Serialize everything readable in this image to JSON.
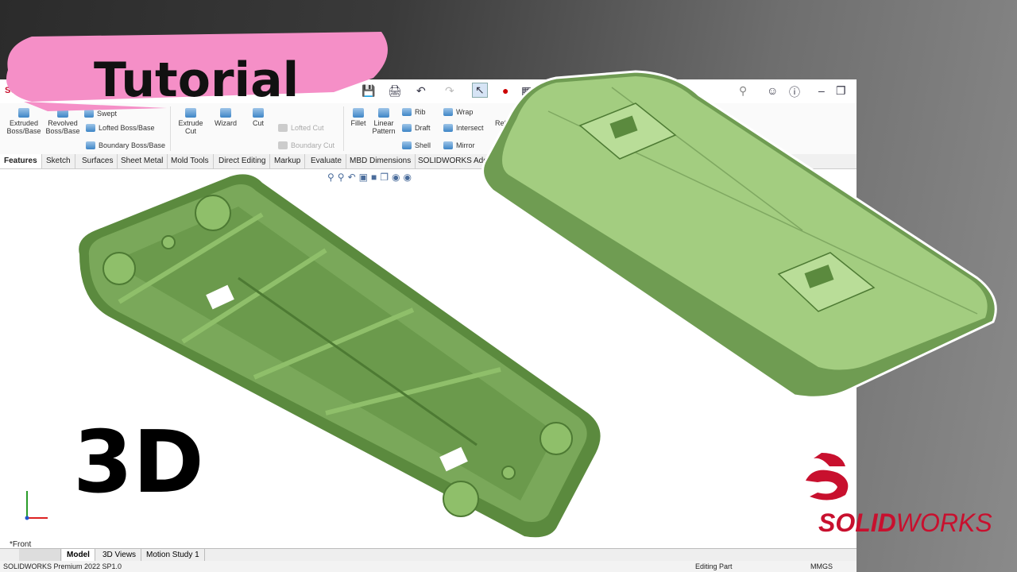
{
  "thumbnail": {
    "tutorial_label": "Tutorial",
    "big_label": "3D",
    "brand": {
      "bold": "SOLID",
      "thin": "WORKS"
    }
  },
  "app": {
    "logo_text": "SOLIDWORKS",
    "ribbon": {
      "extruded": "Extruded Boss/Base",
      "revolved": "Revolved Boss/Base",
      "swept": "Swept",
      "lofted": "Lofted Boss/Base",
      "boundary": "Boundary Boss/Base",
      "extrude_cut": "Extrude Cut",
      "hole_wizard": "Wizard",
      "cut": "Cut",
      "lofted_cut": "Lofted Cut",
      "boundary_cut": "Boundary Cut",
      "fillet": "Fillet",
      "linear_pattern": "Linear Pattern",
      "rib": "Rib",
      "draft": "Draft",
      "shell": "Shell",
      "wrap": "Wrap",
      "intersect": "Intersect",
      "mirror": "Mirror",
      "ref": "Ref"
    },
    "tabs": [
      "Features",
      "Sketch",
      "Surfaces",
      "Sheet Metal",
      "Mold Tools",
      "Direct Editing",
      "Markup",
      "Evaluate",
      "MBD Dimensions",
      "SOLIDWORKS Add-"
    ],
    "view_label": "*Front",
    "bottom_tabs": [
      "Model",
      "3D Views",
      "Motion Study 1"
    ],
    "status": {
      "version": "SOLIDWORKS Premium 2022 SP1.0",
      "mode": "Editing Part",
      "units": "MMGS"
    }
  },
  "colors": {
    "part_green": "#8fbf6a",
    "part_dark": "#5b8a3e",
    "brush_pink": "#f58fc7",
    "brand_red": "#c8102e"
  }
}
